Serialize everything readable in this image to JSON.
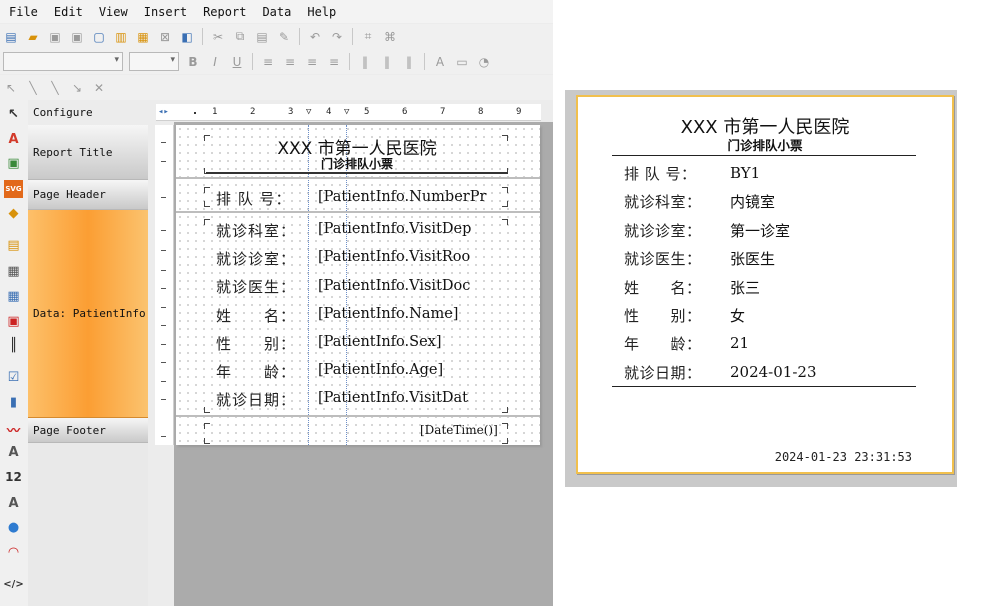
{
  "menu": [
    "File",
    "Edit",
    "View",
    "Insert",
    "Report",
    "Data",
    "Help"
  ],
  "bands": {
    "configure": "Configure",
    "report_title": "Report Title",
    "page_header": "Page Header",
    "data": "Data: PatientInfo",
    "page_footer": "Page Footer"
  },
  "ruler": [
    "1",
    "2",
    "3",
    "4",
    "5",
    "6",
    "7",
    "8",
    "9"
  ],
  "design": {
    "title": "XXX 市第一人民医院",
    "subtitle": "门诊排队小票",
    "queue_label": "排 队 号：",
    "queue_field": "[PatientInfo.NumberPr",
    "rows": [
      {
        "label": "就诊科室：",
        "field": "[PatientInfo.VisitDep"
      },
      {
        "label": "就诊诊室：",
        "field": "[PatientInfo.VisitRoo"
      },
      {
        "label": "就诊医生：",
        "field": "[PatientInfo.VisitDoc"
      },
      {
        "label": "姓　　名：",
        "field": "[PatientInfo.Name]"
      },
      {
        "label": "性　　别：",
        "field": "[PatientInfo.Sex]"
      },
      {
        "label": "年　　龄：",
        "field": "[PatientInfo.Age]"
      },
      {
        "label": "就诊日期：",
        "field": "[PatientInfo.VisitDat"
      }
    ],
    "footer_field": "[DateTime()]"
  },
  "preview": {
    "title": "XXX 市第一人民医院",
    "subtitle": "门诊排队小票",
    "rows": [
      {
        "label": "排 队 号：",
        "value": "BY1"
      },
      {
        "label": "就诊科室：",
        "value": "内镜室"
      },
      {
        "label": "就诊诊室：",
        "value": "第一诊室"
      },
      {
        "label": "就诊医生：",
        "value": "张医生"
      },
      {
        "label": "姓　　名：",
        "value": "张三"
      },
      {
        "label": "性　　别：",
        "value": "女"
      },
      {
        "label": "年　　龄：",
        "value": "21"
      },
      {
        "label": "就诊日期：",
        "value": "2024-01-23"
      }
    ],
    "timestamp": "2024-01-23 23:31:53"
  },
  "colors": {
    "band_orange": "#fb9e33",
    "preview_border": "#f1c04d",
    "guide": "#6d8fc9"
  }
}
